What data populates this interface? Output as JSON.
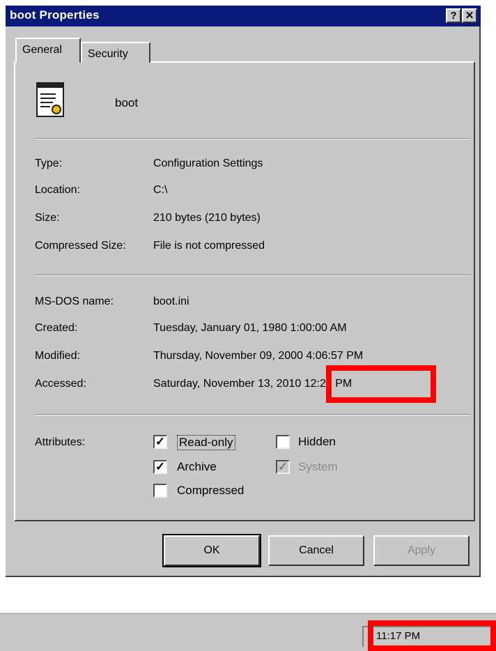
{
  "window": {
    "title": "boot Properties",
    "help_button": "?",
    "close_button": "✕"
  },
  "tabs": [
    {
      "label": "General"
    },
    {
      "label": "Security"
    }
  ],
  "file": {
    "name": "boot",
    "icon": "config-file-icon"
  },
  "details": [
    {
      "label": "Type:",
      "value": "Configuration Settings"
    },
    {
      "label": "Location:",
      "value": "C:\\"
    },
    {
      "label": "Size:",
      "value": "210 bytes (210 bytes)"
    },
    {
      "label": "Compressed Size:",
      "value": "File is not compressed"
    }
  ],
  "dates": [
    {
      "label": "MS-DOS name:",
      "value": "boot.ini"
    },
    {
      "label": "Created:",
      "value": "Tuesday, January 01, 1980 1:00:00 AM"
    },
    {
      "label": "Modified:",
      "value": "Thursday, November 09, 2000 4:06:57 PM"
    },
    {
      "label": "Accessed:",
      "value": "Saturday, November 13, 2010 12:20 PM"
    }
  ],
  "attributes": {
    "label": "Attributes:",
    "items": [
      {
        "label": "Read-only",
        "checked": true,
        "enabled": true
      },
      {
        "label": "Hidden",
        "checked": false,
        "enabled": true
      },
      {
        "label": "Archive",
        "checked": true,
        "enabled": true
      },
      {
        "label": "System",
        "checked": true,
        "enabled": false
      },
      {
        "label": "Compressed",
        "checked": false,
        "enabled": true
      }
    ]
  },
  "buttons": {
    "ok": "OK",
    "cancel": "Cancel",
    "apply": "Apply"
  },
  "taskbar": {
    "clock": "11:17 PM"
  },
  "colors": {
    "titlebar": "#0a1a7a",
    "highlight": "#ff0000",
    "face": "#c8c8c8"
  }
}
